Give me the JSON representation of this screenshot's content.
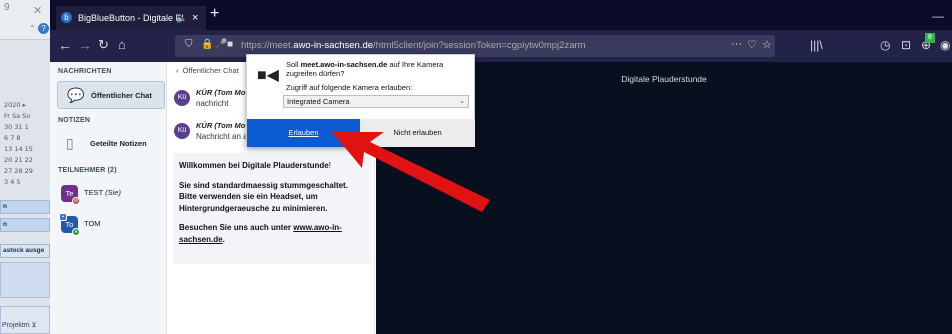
{
  "background_window": {
    "num": "9",
    "calendar_lines": [
      "2020  ▸",
      "Fr  Sa  So",
      "30  31   1",
      " 6   7   8",
      "13  14  15",
      "20  21  22",
      "27  28  29",
      " 3   4   5"
    ],
    "button_a": "n",
    "button_b": "n",
    "item_c": "astock ausge",
    "bottom_label": "Projektm ⊻"
  },
  "browser": {
    "tab_title": "BigBlueButton - Digitale Pl",
    "url_domain": "https://meet.",
    "url_host": "awo-in-sachsen.de",
    "url_path": "/html5client/join?sessionToken=cgpiytw0mpj2zarm",
    "colors": {
      "tabbar": "#0c0c2a",
      "navbar": "#23234a"
    }
  },
  "sidebar": {
    "messages_header": "NACHRICHTEN",
    "public_chat": "Öffentlicher Chat",
    "notes_header": "NOTIZEN",
    "shared_notes": "Geteilte Notizen",
    "participants_header": "TEILNEHMER (2)",
    "users": [
      {
        "initials": "Te",
        "name": "TEST",
        "suffix": "(Sie)",
        "color": "#6e2f8f"
      },
      {
        "initials": "To",
        "name": "TOM",
        "color": "#2458a8"
      }
    ]
  },
  "chat": {
    "back_label": "Öffentlicher Chat",
    "messages": [
      {
        "initials": "Kü",
        "sender": "KÜR (Tom Mo",
        "text": "nachricht"
      },
      {
        "initials": "Kü",
        "sender": "KÜR (Tom Mo",
        "text": "Nachricht an a"
      }
    ],
    "welcome_prefix": "Willkommen bei ",
    "welcome_name": "Digitale Plauderstunde",
    "welcome_suffix": "!",
    "welcome_body": "Sie sind standardmaessig stummgeschaltet. Bitte verwenden sie ein Headset, um Hintergrundgeraeusche zu minimieren.",
    "visit_prefix": "Besuchen Sie uns auch unter ",
    "visit_link": "www.awo-in-sachsen.de",
    "visit_suffix": "."
  },
  "conference": {
    "title": "Digitale Plauderstunde"
  },
  "permission_popup": {
    "question_prefix": "Soll ",
    "question_host": "meet.awo-in-sachsen.de",
    "question_suffix": " auf Ihre Kamera zugreifen dürfen?",
    "device_label": "Zugriff auf folgende Kamera erlauben:",
    "selected_device": "Integrated Camera",
    "allow_label": "Erlauben",
    "deny_label": "Nicht erlauben",
    "allow_color": "#0a5bd0"
  },
  "annotation": {
    "arrow_color": "#e01212"
  }
}
